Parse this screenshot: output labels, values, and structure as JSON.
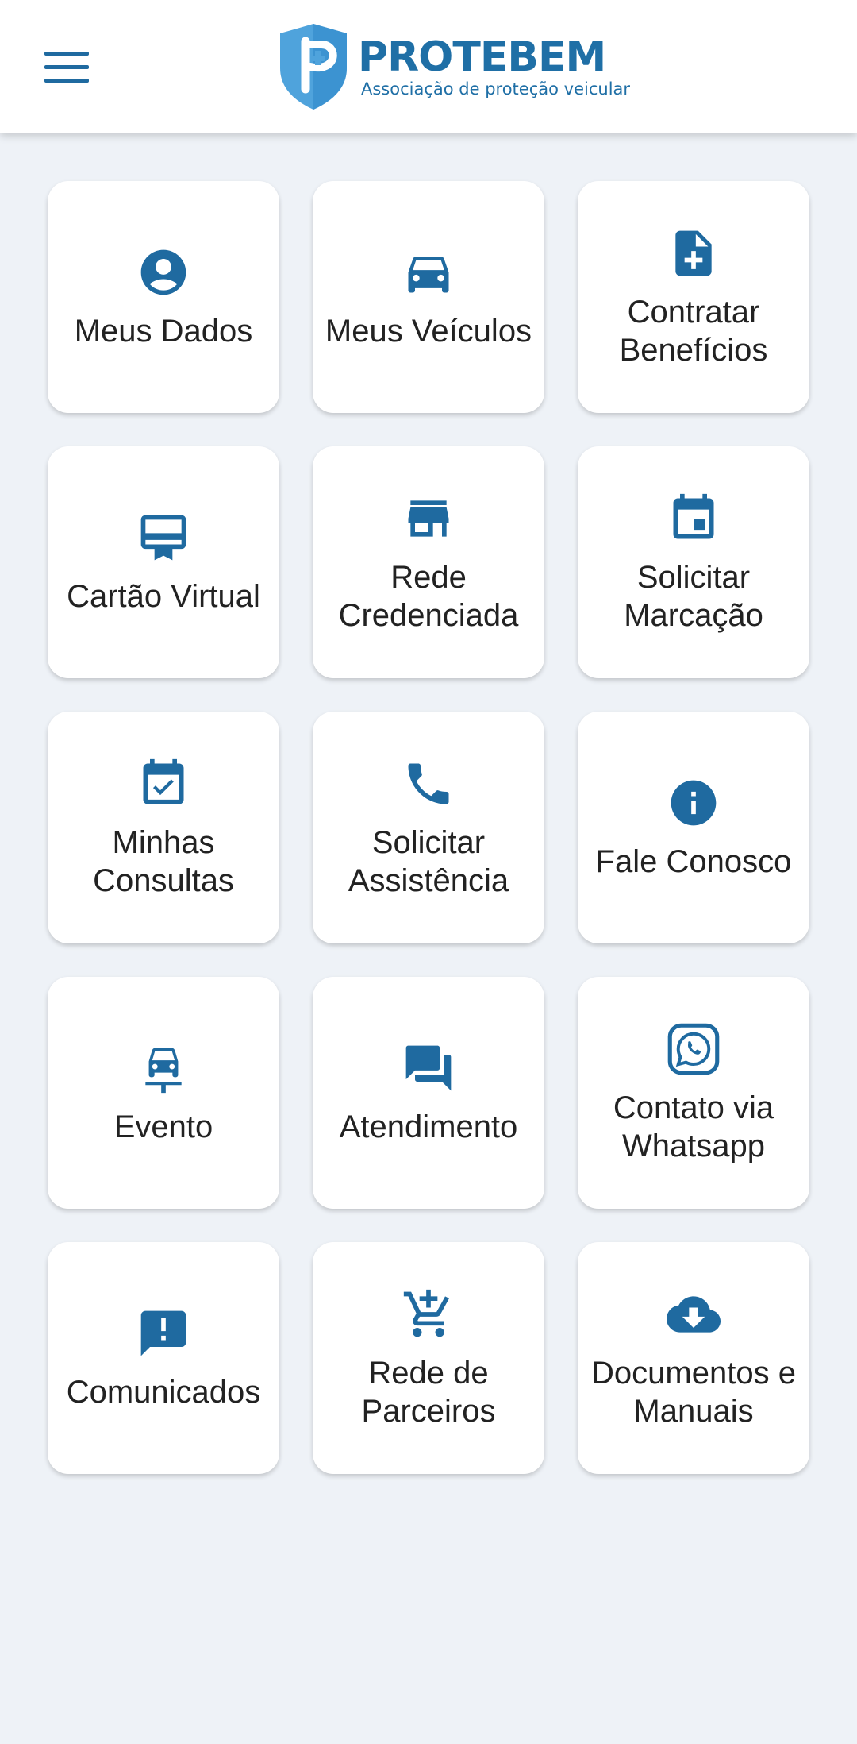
{
  "colors": {
    "accent": "#1f6aa0",
    "logo_light": "#4fa3dc",
    "logo_dark": "#1f6fa6",
    "background": "#eef2f7",
    "tile": "#ffffff",
    "text": "#222222"
  },
  "header": {
    "menu_icon": "menu-icon",
    "logo": {
      "name": "PROTEBEM",
      "tagline": "Associação de proteção veicular"
    }
  },
  "tiles": [
    {
      "label": "Meus Dados",
      "icon": "account-circle-icon"
    },
    {
      "label": "Meus Veículos",
      "icon": "car-icon"
    },
    {
      "label": "Contratar Benefícios",
      "icon": "document-add-icon"
    },
    {
      "label": "Cartão Virtual",
      "icon": "card-membership-icon"
    },
    {
      "label": "Rede Credenciada",
      "icon": "store-icon"
    },
    {
      "label": "Solicitar Marcação",
      "icon": "calendar-event-icon"
    },
    {
      "label": "Minhas Consultas",
      "icon": "calendar-check-icon"
    },
    {
      "label": "Solicitar Assistência",
      "icon": "phone-icon"
    },
    {
      "label": "Fale Conosco",
      "icon": "info-icon"
    },
    {
      "label": "Evento",
      "icon": "car-crash-icon"
    },
    {
      "label": "Atendimento",
      "icon": "chat-icon"
    },
    {
      "label": "Contato via Whatsapp",
      "icon": "whatsapp-icon"
    },
    {
      "label": "Comunicados",
      "icon": "announcement-icon"
    },
    {
      "label": "Rede de Parceiros",
      "icon": "add-shopping-cart-icon"
    },
    {
      "label": "Documentos e Manuais",
      "icon": "cloud-download-icon"
    }
  ]
}
